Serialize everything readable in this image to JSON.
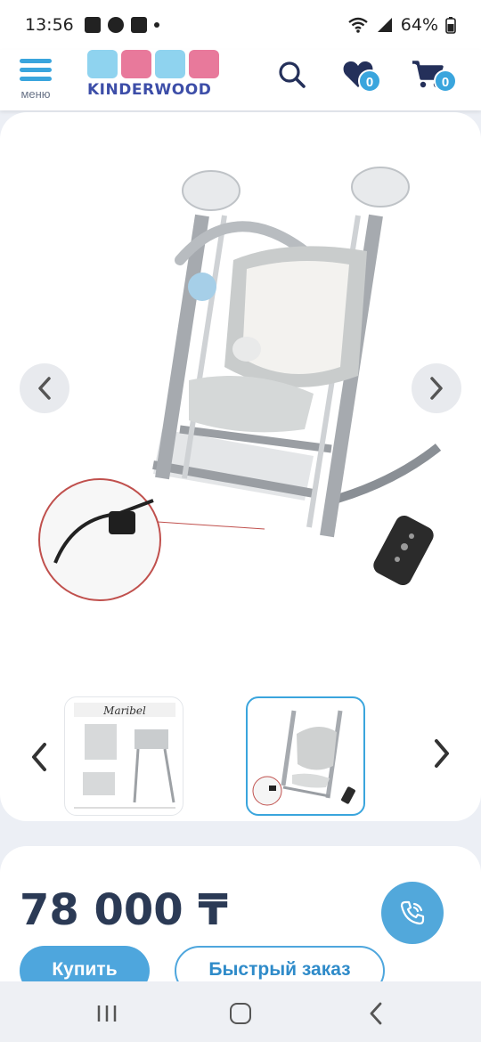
{
  "status_bar": {
    "time": "13:56",
    "battery": "64%"
  },
  "header": {
    "menu_label": "меню",
    "logo_text": "KINDERWOOD",
    "favorites_count": "0",
    "cart_count": "0"
  },
  "gallery": {
    "main_image": "baby-swing-chair-with-adapter-and-remote",
    "thumbnails": [
      {
        "image": "maribel-highchair-collage",
        "brand_text": "Maribel",
        "selected": false
      },
      {
        "image": "baby-swing-chair-with-adapter",
        "selected": true
      }
    ]
  },
  "product": {
    "price": "78 000 ₸",
    "buy_label": "Купить",
    "quick_order_label": "Быстрый заказ"
  },
  "colors": {
    "accent": "#3aa5dd",
    "logo_blue": "#3d4ea8",
    "text_dark": "#2b3a55"
  }
}
